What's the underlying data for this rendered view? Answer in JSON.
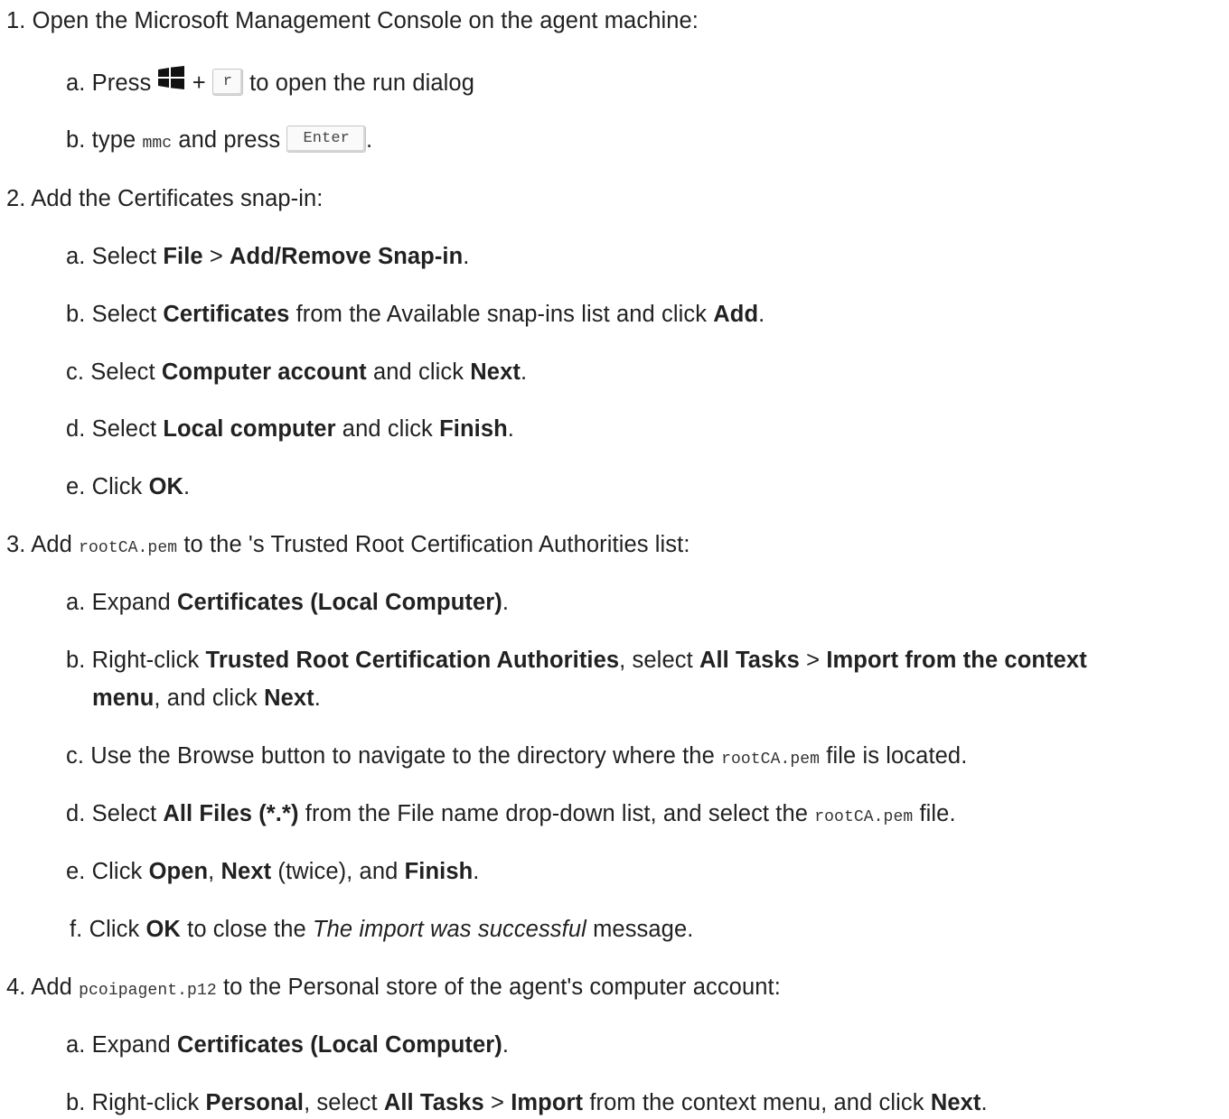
{
  "steps": [
    {
      "number": "1.",
      "intro": "Open the Microsoft Management Console on the agent machine:",
      "substeps": [
        {
          "letter": "a.",
          "press": "Press",
          "plus": "+",
          "key": "r",
          "rest": "to open the run dialog"
        },
        {
          "letter": "b.",
          "pre": "type",
          "code": "mmc",
          "mid": "and press",
          "key": "Enter",
          "post": "."
        }
      ]
    },
    {
      "number": "2.",
      "intro": "Add the Certificates snap-in:",
      "substeps": [
        {
          "letter": "a.",
          "t1": "Select",
          "b1": "File",
          "t2": ">",
          "b2": "Add/Remove Snap-in",
          "t3": "."
        },
        {
          "letter": "b.",
          "t1": "Select",
          "b1": "Certificates",
          "t2": "from the Available snap-ins list and click",
          "b2": "Add",
          "t3": "."
        },
        {
          "letter": "c.",
          "t1": "Select",
          "b1": "Computer account",
          "t2": "and click",
          "b2": "Next",
          "t3": "."
        },
        {
          "letter": "d.",
          "t1": "Select",
          "b1": "Local computer",
          "t2": "and click",
          "b2": "Finish",
          "t3": "."
        },
        {
          "letter": "e.",
          "t1": "Click",
          "b1": "OK",
          "t2": "."
        }
      ]
    },
    {
      "number": "3.",
      "intro_pre": "Add",
      "intro_code": "rootCA.pem",
      "intro_post": "to the 's Trusted Root Certification Authorities list:",
      "substeps": [
        {
          "letter": "a.",
          "t1": "Expand",
          "b1": "Certificates (Local Computer)",
          "t2": "."
        },
        {
          "letter": "b.",
          "t1": "Right-click",
          "b1": "Trusted Root Certification Authorities",
          "t2": ", select",
          "b2": "All Tasks",
          "t3": ">",
          "b3": "Import from the context",
          "b4": "menu",
          "t4": ", and click",
          "b5": "Next",
          "t5": "."
        },
        {
          "letter": "c.",
          "t1": "Use the Browse button to navigate to the directory where the",
          "code": "rootCA.pem",
          "t2": "file is located."
        },
        {
          "letter": "d.",
          "t1": "Select",
          "b1": "All Files (*.*)",
          "t2": "from the File name drop-down list, and select the",
          "code": "rootCA.pem",
          "t3": "file."
        },
        {
          "letter": "e.",
          "t1": "Click",
          "b1": "Open",
          "t2": ",",
          "b2": "Next",
          "t3": "(twice), and",
          "b3": "Finish",
          "t4": "."
        },
        {
          "letter": "f.",
          "t1": "Click",
          "b1": "OK",
          "t2": "to close the",
          "em": "The import was successful",
          "t3": "message."
        }
      ]
    },
    {
      "number": "4.",
      "intro_pre": "Add",
      "intro_code": "pcoipagent.p12",
      "intro_post": "to the Personal store of the agent's computer account:",
      "substeps": [
        {
          "letter": "a.",
          "t1": "Expand",
          "b1": "Certificates (Local Computer)",
          "t2": "."
        },
        {
          "letter": "b.",
          "t1": "Right-click",
          "b1": "Personal",
          "t2": ", select",
          "b2": "All Tasks",
          "t3": ">",
          "b3": "Import",
          "t4": "from the context menu, and click",
          "b4": "Next",
          "t5": "."
        }
      ]
    }
  ],
  "icons": {
    "windows_key": "windows-logo-icon"
  }
}
